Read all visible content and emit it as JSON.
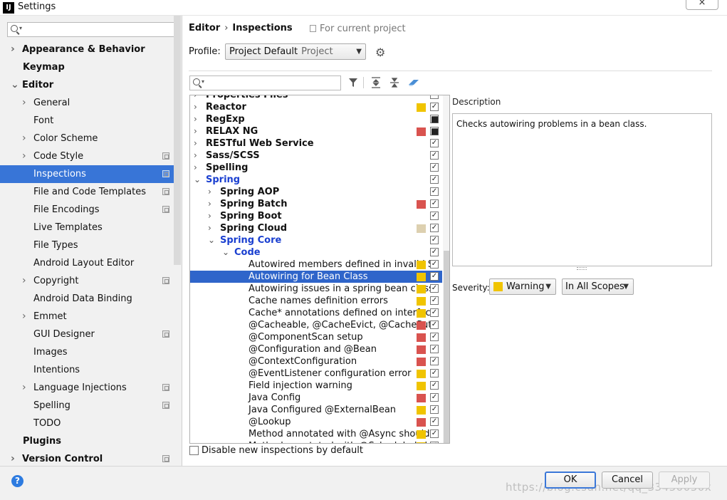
{
  "window": {
    "title": "Settings",
    "app_icon": "IJ",
    "close_label": "×"
  },
  "left": {
    "search_placeholder": "",
    "nav": [
      {
        "label": "Appearance & Behavior",
        "level": 0,
        "bold": true,
        "chevron": "›",
        "project": false,
        "selected": false
      },
      {
        "label": "Keymap",
        "level": 0,
        "bold": true,
        "chevron": "",
        "project": false,
        "selected": false
      },
      {
        "label": "Editor",
        "level": 0,
        "bold": true,
        "chevron": "⌄",
        "project": false,
        "selected": false
      },
      {
        "label": "General",
        "level": 1,
        "bold": false,
        "chevron": "›",
        "project": false,
        "selected": false
      },
      {
        "label": "Font",
        "level": 1,
        "bold": false,
        "chevron": "",
        "project": false,
        "selected": false
      },
      {
        "label": "Color Scheme",
        "level": 1,
        "bold": false,
        "chevron": "›",
        "project": false,
        "selected": false
      },
      {
        "label": "Code Style",
        "level": 1,
        "bold": false,
        "chevron": "›",
        "project": true,
        "selected": false
      },
      {
        "label": "Inspections",
        "level": 1,
        "bold": false,
        "chevron": "",
        "project": true,
        "selected": true
      },
      {
        "label": "File and Code Templates",
        "level": 1,
        "bold": false,
        "chevron": "",
        "project": true,
        "selected": false
      },
      {
        "label": "File Encodings",
        "level": 1,
        "bold": false,
        "chevron": "",
        "project": true,
        "selected": false
      },
      {
        "label": "Live Templates",
        "level": 1,
        "bold": false,
        "chevron": "",
        "project": false,
        "selected": false
      },
      {
        "label": "File Types",
        "level": 1,
        "bold": false,
        "chevron": "",
        "project": false,
        "selected": false
      },
      {
        "label": "Android Layout Editor",
        "level": 1,
        "bold": false,
        "chevron": "",
        "project": false,
        "selected": false
      },
      {
        "label": "Copyright",
        "level": 1,
        "bold": false,
        "chevron": "›",
        "project": true,
        "selected": false
      },
      {
        "label": "Android Data Binding",
        "level": 1,
        "bold": false,
        "chevron": "",
        "project": false,
        "selected": false
      },
      {
        "label": "Emmet",
        "level": 1,
        "bold": false,
        "chevron": "›",
        "project": false,
        "selected": false
      },
      {
        "label": "GUI Designer",
        "level": 1,
        "bold": false,
        "chevron": "",
        "project": true,
        "selected": false
      },
      {
        "label": "Images",
        "level": 1,
        "bold": false,
        "chevron": "",
        "project": false,
        "selected": false
      },
      {
        "label": "Intentions",
        "level": 1,
        "bold": false,
        "chevron": "",
        "project": false,
        "selected": false
      },
      {
        "label": "Language Injections",
        "level": 1,
        "bold": false,
        "chevron": "›",
        "project": true,
        "selected": false
      },
      {
        "label": "Spelling",
        "level": 1,
        "bold": false,
        "chevron": "",
        "project": true,
        "selected": false
      },
      {
        "label": "TODO",
        "level": 1,
        "bold": false,
        "chevron": "",
        "project": false,
        "selected": false
      },
      {
        "label": "Plugins",
        "level": 0,
        "bold": true,
        "chevron": "",
        "project": false,
        "selected": false
      },
      {
        "label": "Version Control",
        "level": 0,
        "bold": true,
        "chevron": "›",
        "project": true,
        "selected": false
      }
    ]
  },
  "header": {
    "crumb1": "Editor",
    "crumb_sep": "›",
    "crumb2": "Inspections",
    "for_project": "For current project"
  },
  "profile": {
    "label": "Profile:",
    "value": "Project Default",
    "kind": "Project"
  },
  "inspections_search": {
    "placeholder": ""
  },
  "tree": [
    {
      "label": "Properties Files",
      "indent": 0,
      "chevron": "›",
      "bold": true,
      "blue": false,
      "color": "",
      "check": "checked",
      "selected": false
    },
    {
      "label": "Reactor",
      "indent": 0,
      "chevron": "›",
      "bold": true,
      "blue": false,
      "color": "#f0c400",
      "check": "checked",
      "selected": false
    },
    {
      "label": "RegExp",
      "indent": 0,
      "chevron": "›",
      "bold": true,
      "blue": false,
      "color": "",
      "check": "mixed",
      "selected": false
    },
    {
      "label": "RELAX NG",
      "indent": 0,
      "chevron": "›",
      "bold": true,
      "blue": false,
      "color": "#d9534f",
      "check": "mixed",
      "selected": false
    },
    {
      "label": "RESTful Web Service",
      "indent": 0,
      "chevron": "›",
      "bold": true,
      "blue": false,
      "color": "",
      "check": "checked",
      "selected": false
    },
    {
      "label": "Sass/SCSS",
      "indent": 0,
      "chevron": "›",
      "bold": true,
      "blue": false,
      "color": "",
      "check": "checked",
      "selected": false
    },
    {
      "label": "Spelling",
      "indent": 0,
      "chevron": "›",
      "bold": true,
      "blue": false,
      "color": "",
      "check": "checked",
      "selected": false
    },
    {
      "label": "Spring",
      "indent": 0,
      "chevron": "⌄",
      "bold": true,
      "blue": true,
      "color": "",
      "check": "checked",
      "selected": false
    },
    {
      "label": "Spring AOP",
      "indent": 1,
      "chevron": "›",
      "bold": true,
      "blue": false,
      "color": "",
      "check": "checked",
      "selected": false
    },
    {
      "label": "Spring Batch",
      "indent": 1,
      "chevron": "›",
      "bold": true,
      "blue": false,
      "color": "#d9534f",
      "check": "checked",
      "selected": false
    },
    {
      "label": "Spring Boot",
      "indent": 1,
      "chevron": "›",
      "bold": true,
      "blue": false,
      "color": "",
      "check": "checked",
      "selected": false
    },
    {
      "label": "Spring Cloud",
      "indent": 1,
      "chevron": "›",
      "bold": true,
      "blue": false,
      "color": "#ddd0b0",
      "check": "checked",
      "selected": false
    },
    {
      "label": "Spring Core",
      "indent": 1,
      "chevron": "⌄",
      "bold": true,
      "blue": true,
      "color": "",
      "check": "checked",
      "selected": false
    },
    {
      "label": "Code",
      "indent": 2,
      "chevron": "⌄",
      "bold": true,
      "blue": true,
      "color": "",
      "check": "checked",
      "selected": false
    },
    {
      "label": "Autowired members defined in invalid S",
      "indent": 3,
      "chevron": "",
      "bold": false,
      "blue": false,
      "color": "#f0c400",
      "check": "checked",
      "selected": false
    },
    {
      "label": "Autowiring for Bean Class",
      "indent": 3,
      "chevron": "",
      "bold": false,
      "blue": false,
      "color": "#f0c400",
      "check": "checked",
      "selected": true
    },
    {
      "label": "Autowiring issues in a spring bean class",
      "indent": 3,
      "chevron": "",
      "bold": false,
      "blue": false,
      "color": "#f0c400",
      "check": "checked",
      "selected": false
    },
    {
      "label": "Cache names definition errors",
      "indent": 3,
      "chevron": "",
      "bold": false,
      "blue": false,
      "color": "#f0c400",
      "check": "checked",
      "selected": false
    },
    {
      "label": "Cache* annotations defined on interface",
      "indent": 3,
      "chevron": "",
      "bold": false,
      "blue": false,
      "color": "#f0c400",
      "check": "checked",
      "selected": false
    },
    {
      "label": "@Cacheable, @CacheEvict, @CachePut,",
      "indent": 3,
      "chevron": "",
      "bold": false,
      "blue": false,
      "color": "#d9534f",
      "check": "checked",
      "selected": false
    },
    {
      "label": "@ComponentScan setup",
      "indent": 3,
      "chevron": "",
      "bold": false,
      "blue": false,
      "color": "#d9534f",
      "check": "checked",
      "selected": false
    },
    {
      "label": "@Configuration and @Bean",
      "indent": 3,
      "chevron": "",
      "bold": false,
      "blue": false,
      "color": "#d9534f",
      "check": "checked",
      "selected": false
    },
    {
      "label": "@ContextConfiguration",
      "indent": 3,
      "chevron": "",
      "bold": false,
      "blue": false,
      "color": "#d9534f",
      "check": "checked",
      "selected": false
    },
    {
      "label": "@EventListener configuration error",
      "indent": 3,
      "chevron": "",
      "bold": false,
      "blue": false,
      "color": "#f0c400",
      "check": "checked",
      "selected": false
    },
    {
      "label": "Field injection warning",
      "indent": 3,
      "chevron": "",
      "bold": false,
      "blue": false,
      "color": "#f0c400",
      "check": "checked",
      "selected": false
    },
    {
      "label": "Java Config",
      "indent": 3,
      "chevron": "",
      "bold": false,
      "blue": false,
      "color": "#d9534f",
      "check": "checked",
      "selected": false
    },
    {
      "label": "Java Configured @ExternalBean",
      "indent": 3,
      "chevron": "",
      "bold": false,
      "blue": false,
      "color": "#f0c400",
      "check": "checked",
      "selected": false
    },
    {
      "label": "@Lookup",
      "indent": 3,
      "chevron": "",
      "bold": false,
      "blue": false,
      "color": "#d9534f",
      "check": "checked",
      "selected": false
    },
    {
      "label": "Method annotated with @Async should",
      "indent": 3,
      "chevron": "",
      "bold": false,
      "blue": false,
      "color": "#f0c400",
      "check": "checked",
      "selected": false
    },
    {
      "label": "Method annotated with @Scheduled sh",
      "indent": 3,
      "chevron": "",
      "bold": false,
      "blue": false,
      "color": "#f0c400",
      "check": "checked",
      "selected": false
    }
  ],
  "description": {
    "label": "Description",
    "text": "Checks autowiring problems in a bean class."
  },
  "severity": {
    "label": "Severity:",
    "value": "Warning",
    "color": "#f0c400",
    "scope": "In All Scopes"
  },
  "disable_new": {
    "label": "Disable new inspections by default"
  },
  "buttons": {
    "ok": "OK",
    "cancel": "Cancel",
    "apply": "Apply",
    "help": "?"
  },
  "watermark": "https://blog.csdn.net/qq_33450050x"
}
